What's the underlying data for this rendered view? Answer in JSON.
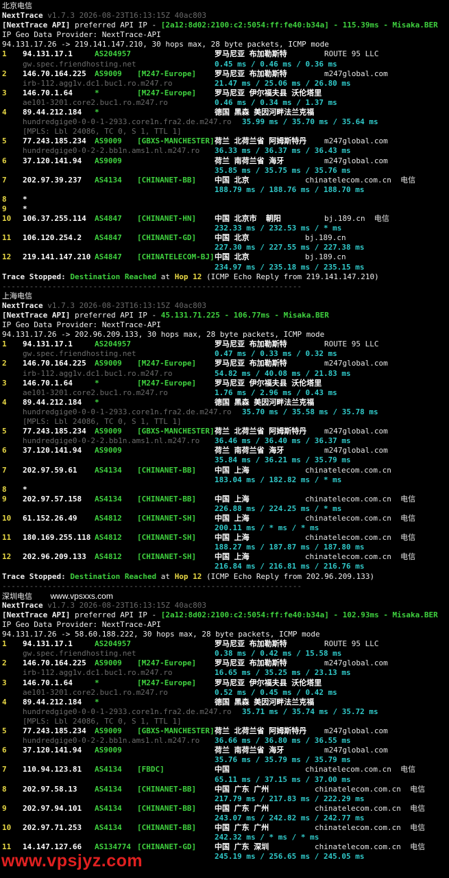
{
  "sections": [
    {
      "title": "北京电信",
      "watermark": "",
      "nt_name": "NextTrace",
      "nt_version": "v1.7.3 2026-08-23T16:13:15Z 40ac803",
      "api_prefix": "[NextTrace API]",
      "api_mid": " preferred API IP - ",
      "api_ip": "[2a12:8d02:2100:c2:5054:ff:fe40:b34a]",
      "api_latency": " - 115.39ms - Misaka.BER",
      "geo_provider": "IP Geo Data Provider: NextTrace-API",
      "route": "94.131.17.26 -> 219.141.147.210, 30 hops max, 28 byte packets, ICMP mode",
      "hops": [
        {
          "hop": "1",
          "ip": "94.131.17.1",
          "asn": "AS204957",
          "tag": "",
          "geo": "罗马尼亚 布加勒斯特",
          "domain": "ROUTE 95 LLC",
          "host": "gw.spec.friendhosting.net",
          "rtt": "0.45 ms / 0.46 ms / 0.36 ms",
          "extra": "",
          "rtt_inline": ""
        },
        {
          "hop": "2",
          "ip": "146.70.164.225",
          "asn": "AS9009",
          "tag": "[M247-Europe]",
          "geo": "罗马尼亚 布加勒斯特",
          "domain": "m247global.com",
          "host": "irb-112.agg1v.dc1.buc1.ro.m247.ro",
          "rtt": "21.47 ms / 25.06 ms / 26.80 ms",
          "extra": "",
          "rtt_inline": ""
        },
        {
          "hop": "3",
          "ip": "146.70.1.64",
          "asn": "*",
          "tag": "[M247-Europe]",
          "geo": "罗马尼亚 伊尔福夫县 沃伦塔里",
          "domain": "",
          "host": "ae101-3201.core2.buc1.ro.m247.ro",
          "rtt": "0.46 ms / 0.34 ms / 1.37 ms",
          "extra": "",
          "rtt_inline": ""
        },
        {
          "hop": "4",
          "ip": "89.44.212.184",
          "asn": "*",
          "tag": "",
          "geo": "德国 黑森 美因河畔法兰克福",
          "domain": "",
          "host": "hundredgige0-0-0-1-2933.core1n.fra2.de.m247.ro",
          "rtt": "",
          "extra": "[MPLS: Lbl 24086, TC 0, S 1, TTL 1]",
          "rtt_inline": "35.99 ms / 35.70 ms / 35.64 ms"
        },
        {
          "hop": "5",
          "ip": "77.243.185.234",
          "asn": "AS9009",
          "tag": "[GBXS-MANCHESTER]",
          "geo": "荷兰 北荷兰省 阿姆斯特丹",
          "domain": "m247global.com",
          "host": "hundredgige0-0-2-2.bb1n.ams1.nl.m247.ro",
          "rtt": "36.33 ms / 36.37 ms / 36.43 ms",
          "extra": "",
          "rtt_inline": ""
        },
        {
          "hop": "6",
          "ip": "37.120.141.94",
          "asn": "AS9009",
          "tag": "",
          "geo": "荷兰 南荷兰省 海牙",
          "domain": "m247global.com",
          "host": "",
          "rtt": "35.85 ms / 35.75 ms / 35.76 ms",
          "extra": "",
          "rtt_inline": ""
        },
        {
          "hop": "7",
          "ip": "202.97.39.237",
          "asn": "AS4134",
          "tag": "[CHINANET-BB]",
          "geo": "中国 北京",
          "domain": "chinatelecom.com.cn  电信",
          "host": "",
          "rtt": "188.79 ms / 188.76 ms / 188.70 ms",
          "extra": "",
          "rtt_inline": ""
        },
        {
          "hop": "8",
          "ip": "*",
          "asn": "",
          "tag": "",
          "geo": "",
          "domain": "",
          "host": "",
          "rtt": "",
          "extra": "",
          "rtt_inline": ""
        },
        {
          "hop": "9",
          "ip": "*",
          "asn": "",
          "tag": "",
          "geo": "",
          "domain": "",
          "host": "",
          "rtt": "",
          "extra": "",
          "rtt_inline": ""
        },
        {
          "hop": "10",
          "ip": "106.37.255.114",
          "asn": "AS4847",
          "tag": "[CHINANET-HN]",
          "geo": "中国 北京市  朝阳",
          "domain": "bj.189.cn  电信",
          "host": "",
          "rtt": "232.33 ms / 232.53 ms / * ms",
          "extra": "",
          "rtt_inline": ""
        },
        {
          "hop": "11",
          "ip": "106.120.254.2",
          "asn": "AS4847",
          "tag": "[CHINANET-GD]",
          "geo": "中国 北京",
          "domain": "bj.189.cn",
          "host": "",
          "rtt": "227.30 ms / 227.55 ms / 227.38 ms",
          "extra": "",
          "rtt_inline": ""
        },
        {
          "hop": "12",
          "ip": "219.141.147.210",
          "asn": "AS4847",
          "tag": "[CHINATELECOM-BJ]",
          "geo": "中国 北京",
          "domain": "bj.189.cn",
          "host": "",
          "rtt": "234.97 ms / 235.18 ms / 235.15 ms",
          "extra": "",
          "rtt_inline": ""
        }
      ],
      "stop_prefix": "Trace Stopped: ",
      "stop_reached": "Destination Reached",
      "stop_at": " at ",
      "stop_hop": "Hop 12",
      "stop_tail": " (ICMP Echo Reply from 219.141.147.210)"
    },
    {
      "title": "上海电信",
      "watermark": "",
      "nt_name": "NextTrace",
      "nt_version": "v1.7.3 2026-08-23T16:13:15Z 40ac803",
      "api_prefix": "[NextTrace API]",
      "api_mid": " preferred API IP - ",
      "api_ip": "45.131.71.225",
      "api_latency": " - 106.77ms - Misaka.BER",
      "geo_provider": "IP Geo Data Provider: NextTrace-API",
      "route": "94.131.17.26 -> 202.96.209.133, 30 hops max, 28 byte packets, ICMP mode",
      "hops": [
        {
          "hop": "1",
          "ip": "94.131.17.1",
          "asn": "AS204957",
          "tag": "",
          "geo": "罗马尼亚 布加勒斯特",
          "domain": "ROUTE 95 LLC",
          "host": "gw.spec.friendhosting.net",
          "rtt": "0.47 ms / 0.33 ms / 0.32 ms",
          "extra": "",
          "rtt_inline": ""
        },
        {
          "hop": "2",
          "ip": "146.70.164.225",
          "asn": "AS9009",
          "tag": "[M247-Europe]",
          "geo": "罗马尼亚 布加勒斯特",
          "domain": "m247global.com",
          "host": "irb-112.agg1v.dc1.buc1.ro.m247.ro",
          "rtt": "54.82 ms / 40.08 ms / 21.83 ms",
          "extra": "",
          "rtt_inline": ""
        },
        {
          "hop": "3",
          "ip": "146.70.1.64",
          "asn": "*",
          "tag": "[M247-Europe]",
          "geo": "罗马尼亚 伊尔福夫县 沃伦塔里",
          "domain": "",
          "host": "ae101-3201.core2.buc1.ro.m247.ro",
          "rtt": "1.76 ms / 2.96 ms / 0.43 ms",
          "extra": "",
          "rtt_inline": ""
        },
        {
          "hop": "4",
          "ip": "89.44.212.184",
          "asn": "*",
          "tag": "",
          "geo": "德国 黑森 美因河畔法兰克福",
          "domain": "",
          "host": "hundredgige0-0-0-1-2933.core1n.fra2.de.m247.ro",
          "rtt": "",
          "extra": "[MPLS: Lbl 24086, TC 0, S 1, TTL 1]",
          "rtt_inline": "35.70 ms / 35.58 ms / 35.78 ms"
        },
        {
          "hop": "5",
          "ip": "77.243.185.234",
          "asn": "AS9009",
          "tag": "[GBXS-MANCHESTER]",
          "geo": "荷兰 北荷兰省 阿姆斯特丹",
          "domain": "m247global.com",
          "host": "hundredgige0-0-2-2.bb1n.ams1.nl.m247.ro",
          "rtt": "36.46 ms / 36.40 ms / 36.37 ms",
          "extra": "",
          "rtt_inline": ""
        },
        {
          "hop": "6",
          "ip": "37.120.141.94",
          "asn": "AS9009",
          "tag": "",
          "geo": "荷兰 南荷兰省 海牙",
          "domain": "m247global.com",
          "host": "",
          "rtt": "35.84 ms / 36.21 ms / 35.79 ms",
          "extra": "",
          "rtt_inline": ""
        },
        {
          "hop": "7",
          "ip": "202.97.59.61",
          "asn": "AS4134",
          "tag": "[CHINANET-BB]",
          "geo": "中国 上海",
          "domain": "chinatelecom.com.cn",
          "host": "",
          "rtt": "183.04 ms / 182.82 ms / * ms",
          "extra": "",
          "rtt_inline": ""
        },
        {
          "hop": "8",
          "ip": "*",
          "asn": "",
          "tag": "",
          "geo": "",
          "domain": "",
          "host": "",
          "rtt": "",
          "extra": "",
          "rtt_inline": ""
        },
        {
          "hop": "9",
          "ip": "202.97.57.158",
          "asn": "AS4134",
          "tag": "[CHINANET-BB]",
          "geo": "中国 上海",
          "domain": "chinatelecom.com.cn  电信",
          "host": "",
          "rtt": "226.88 ms / 224.25 ms / * ms",
          "extra": "",
          "rtt_inline": ""
        },
        {
          "hop": "10",
          "ip": "61.152.26.49",
          "asn": "AS4812",
          "tag": "[CHINANET-SH]",
          "geo": "中国 上海",
          "domain": "chinatelecom.com.cn  电信",
          "host": "",
          "rtt": "200.11 ms / * ms / * ms",
          "extra": "",
          "rtt_inline": ""
        },
        {
          "hop": "11",
          "ip": "180.169.255.118",
          "asn": "AS4812",
          "tag": "[CHINANET-SH]",
          "geo": "中国 上海",
          "domain": "chinatelecom.com.cn  电信",
          "host": "",
          "rtt": "188.27 ms / 187.87 ms / 187.80 ms",
          "extra": "",
          "rtt_inline": ""
        },
        {
          "hop": "12",
          "ip": "202.96.209.133",
          "asn": "AS4812",
          "tag": "[CHINANET-SH]",
          "geo": "中国 上海",
          "domain": "chinatelecom.com.cn  电信",
          "host": "",
          "rtt": "216.84 ms / 216.81 ms / 216.76 ms",
          "extra": "",
          "rtt_inline": ""
        }
      ],
      "stop_prefix": "Trace Stopped: ",
      "stop_reached": "Destination Reached",
      "stop_at": " at ",
      "stop_hop": "Hop 12",
      "stop_tail": " (ICMP Echo Reply from 202.96.209.133)"
    },
    {
      "title": "深圳电信",
      "watermark": "www.vpsxxs.com",
      "nt_name": "NextTrace",
      "nt_version": "v1.7.3 2026-08-23T16:13:15Z 40ac803",
      "api_prefix": "[NextTrace API]",
      "api_mid": " preferred API IP - ",
      "api_ip": "[2a12:8d02:2100:c2:5054:ff:fe40:b34a]",
      "api_latency": " - 102.93ms - Misaka.BER",
      "geo_provider": "IP Geo Data Provider: NextTrace-API",
      "route": "94.131.17.26 -> 58.60.188.222, 30 hops max, 28 byte packets, ICMP mode",
      "hops": [
        {
          "hop": "1",
          "ip": "94.131.17.1",
          "asn": "AS204957",
          "tag": "",
          "geo": "罗马尼亚 布加勒斯特",
          "domain": "ROUTE 95 LLC",
          "host": "gw.spec.friendhosting.net",
          "rtt": "0.38 ms / 0.42 ms / 15.58 ms",
          "extra": "",
          "rtt_inline": ""
        },
        {
          "hop": "2",
          "ip": "146.70.164.225",
          "asn": "AS9009",
          "tag": "[M247-Europe]",
          "geo": "罗马尼亚 布加勒斯特",
          "domain": "m247global.com",
          "host": "irb-112.agg1v.dc1.buc1.ro.m247.ro",
          "rtt": "16.65 ms / 35.25 ms / 23.13 ms",
          "extra": "",
          "rtt_inline": ""
        },
        {
          "hop": "3",
          "ip": "146.70.1.64",
          "asn": "*",
          "tag": "[M247-Europe]",
          "geo": "罗马尼亚 伊尔福夫县 沃伦塔里",
          "domain": "",
          "host": "ae101-3201.core2.buc1.ro.m247.ro",
          "rtt": "0.52 ms / 0.45 ms / 0.42 ms",
          "extra": "",
          "rtt_inline": ""
        },
        {
          "hop": "4",
          "ip": "89.44.212.184",
          "asn": "*",
          "tag": "",
          "geo": "德国 黑森 美因河畔法兰克福",
          "domain": "",
          "host": "hundredgige0-0-0-1-2933.core1n.fra2.de.m247.ro",
          "rtt": "",
          "extra": "[MPLS: Lbl 24086, TC 0, S 1, TTL 1]",
          "rtt_inline": "35.71 ms / 35.74 ms / 35.72 ms"
        },
        {
          "hop": "5",
          "ip": "77.243.185.234",
          "asn": "AS9009",
          "tag": "[GBXS-MANCHESTER]",
          "geo": "荷兰 北荷兰省 阿姆斯特丹",
          "domain": "m247global.com",
          "host": "hundredgige0-0-2-2.bb1n.ams1.nl.m247.ro",
          "rtt": "36.66 ms / 36.80 ms / 36.55 ms",
          "extra": "",
          "rtt_inline": ""
        },
        {
          "hop": "6",
          "ip": "37.120.141.94",
          "asn": "AS9009",
          "tag": "",
          "geo": "荷兰 南荷兰省 海牙",
          "domain": "m247global.com",
          "host": "",
          "rtt": "35.76 ms / 35.79 ms / 35.79 ms",
          "extra": "",
          "rtt_inline": ""
        },
        {
          "hop": "7",
          "ip": "110.94.123.81",
          "asn": "AS4134",
          "tag": "[FBDC]",
          "geo": "中国",
          "domain": "chinatelecom.com.cn  电信",
          "host": "",
          "rtt": "65.11 ms / 37.15 ms / 37.00 ms",
          "extra": "",
          "rtt_inline": ""
        },
        {
          "hop": "8",
          "ip": "202.97.58.13",
          "asn": "AS4134",
          "tag": "[CHINANET-BB]",
          "geo": "中国 广东 广州",
          "domain": "chinatelecom.com.cn  电信",
          "host": "",
          "rtt": "217.79 ms / 217.83 ms / 222.29 ms",
          "extra": "",
          "rtt_inline": ""
        },
        {
          "hop": "9",
          "ip": "202.97.94.101",
          "asn": "AS4134",
          "tag": "[CHINANET-BB]",
          "geo": "中国 广东 广州",
          "domain": "chinatelecom.com.cn  电信",
          "host": "",
          "rtt": "243.07 ms / 242.82 ms / 242.77 ms",
          "extra": "",
          "rtt_inline": ""
        },
        {
          "hop": "10",
          "ip": "202.97.71.253",
          "asn": "AS4134",
          "tag": "[CHINANET-BB]",
          "geo": "中国 广东 广州",
          "domain": "chinatelecom.com.cn  电信",
          "host": "",
          "rtt": "242.32 ms / * ms / * ms",
          "extra": "",
          "rtt_inline": ""
        },
        {
          "hop": "11",
          "ip": "14.147.127.66",
          "asn": "AS134774",
          "tag": "[CHINANET-GD]",
          "geo": "中国 广东 深圳",
          "domain": "chinatelecom.com.cn  电信",
          "host": "",
          "rtt": "245.19 ms / 256.65 ms / 245.05 ms",
          "extra": "",
          "rtt_inline": ""
        }
      ],
      "stop_prefix": "",
      "stop_reached": "",
      "stop_at": "",
      "stop_hop": "",
      "stop_tail": ""
    }
  ],
  "separator": "------------------------------------------------------------------",
  "bottom_watermark": "www.vpsjyz.com",
  "colors": {
    "background": "#000000",
    "hop_number": "#e8d845",
    "asn_tag": "#3fd13f",
    "rtt": "#30c8c8",
    "hostname": "#6a6a6a",
    "watermark": "#e02020"
  }
}
